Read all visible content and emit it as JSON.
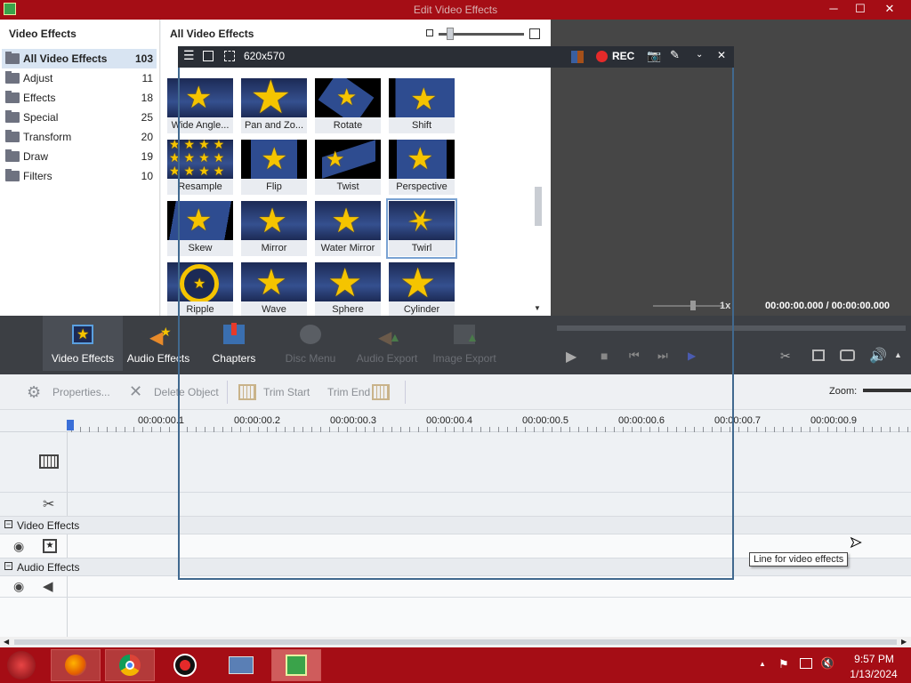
{
  "window": {
    "title": "Edit Video Effects",
    "min": "─",
    "max": "☐",
    "close": "✕"
  },
  "left_panel": {
    "header": "Video Effects",
    "categories": [
      {
        "label": "All Video Effects",
        "count": "103",
        "selected": true
      },
      {
        "label": "Adjust",
        "count": "11"
      },
      {
        "label": "Effects",
        "count": "18"
      },
      {
        "label": "Special",
        "count": "25"
      },
      {
        "label": "Transform",
        "count": "20"
      },
      {
        "label": "Draw",
        "count": "19"
      },
      {
        "label": "Filters",
        "count": "10"
      }
    ]
  },
  "center_panel": {
    "header": "All Video Effects",
    "effects": [
      {
        "label": "Wide Angle..."
      },
      {
        "label": "Pan and Zo..."
      },
      {
        "label": "Rotate"
      },
      {
        "label": "Shift"
      },
      {
        "label": "Resample"
      },
      {
        "label": "Flip"
      },
      {
        "label": "Twist"
      },
      {
        "label": "Perspective"
      },
      {
        "label": "Skew"
      },
      {
        "label": "Mirror"
      },
      {
        "label": "Water Mirror"
      },
      {
        "label": "Twirl",
        "selected": true
      },
      {
        "label": "Ripple"
      },
      {
        "label": "Wave"
      },
      {
        "label": "Sphere"
      },
      {
        "label": "Cylinder"
      }
    ]
  },
  "capture_tool": {
    "size": "620x570",
    "rec": "REC"
  },
  "preview": {
    "speed": "1x",
    "time": "00:00:00.000 / 00:00:00.000"
  },
  "toolbar": {
    "video_effects": "Video Effects",
    "audio_effects": "Audio Effects",
    "chapters": "Chapters",
    "disc_menu": "Disc Menu",
    "audio_export": "Audio Export",
    "image_export": "Image Export"
  },
  "propbar": {
    "properties": "Properties...",
    "delete_object": "Delete Object",
    "trim_start": "Trim Start",
    "trim_end": "Trim End",
    "zoom": "Zoom:"
  },
  "timeline": {
    "ticks": [
      "00:00:00.1",
      "00:00:00.2",
      "00:00:00.3",
      "00:00:00.4",
      "00:00:00.5",
      "00:00:00.6",
      "00:00:00.7",
      "00:00:00.9"
    ],
    "video_effects": "Video Effects",
    "audio_effects": "Audio Effects",
    "tooltip": "Line for video effects"
  },
  "taskbar": {
    "time": "9:57 PM",
    "date": "1/13/2024"
  },
  "colors": {
    "titlebar": "#a50d15",
    "accent": "#41698f",
    "rec": "#e52a2a",
    "star": "#f5c400"
  }
}
